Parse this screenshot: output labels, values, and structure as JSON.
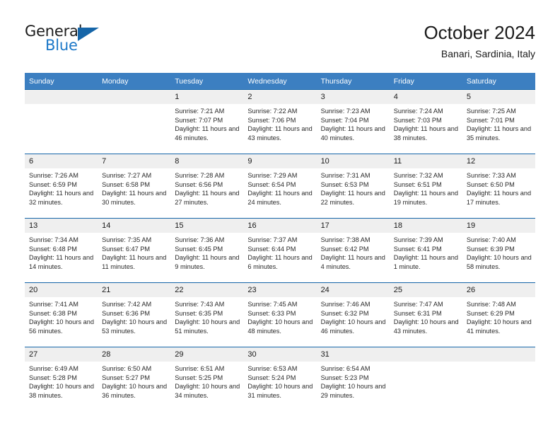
{
  "logo": {
    "word_one": "General",
    "word_two": "Blue",
    "triangle_icon": "blue-triangle-icon",
    "accent_color": "#1c78c8"
  },
  "header": {
    "title": "October 2024",
    "subtitle": "Banari, Sardinia, Italy"
  },
  "theme": {
    "header_blue": "#3c7fc1",
    "rule_blue": "#1565a8",
    "date_band_gray": "#efefef"
  },
  "labels": {
    "sunrise_prefix": "Sunrise:",
    "sunset_prefix": "Sunset:",
    "daylight_prefix": "Daylight:"
  },
  "weekdays": [
    "Sunday",
    "Monday",
    "Tuesday",
    "Wednesday",
    "Thursday",
    "Friday",
    "Saturday"
  ],
  "weeks": [
    [
      {
        "day": "",
        "sunrise": "",
        "sunset": "",
        "daylight": ""
      },
      {
        "day": "",
        "sunrise": "",
        "sunset": "",
        "daylight": ""
      },
      {
        "day": "1",
        "sunrise": "Sunrise: 7:21 AM",
        "sunset": "Sunset: 7:07 PM",
        "daylight": "Daylight: 11 hours and 46 minutes."
      },
      {
        "day": "2",
        "sunrise": "Sunrise: 7:22 AM",
        "sunset": "Sunset: 7:06 PM",
        "daylight": "Daylight: 11 hours and 43 minutes."
      },
      {
        "day": "3",
        "sunrise": "Sunrise: 7:23 AM",
        "sunset": "Sunset: 7:04 PM",
        "daylight": "Daylight: 11 hours and 40 minutes."
      },
      {
        "day": "4",
        "sunrise": "Sunrise: 7:24 AM",
        "sunset": "Sunset: 7:03 PM",
        "daylight": "Daylight: 11 hours and 38 minutes."
      },
      {
        "day": "5",
        "sunrise": "Sunrise: 7:25 AM",
        "sunset": "Sunset: 7:01 PM",
        "daylight": "Daylight: 11 hours and 35 minutes."
      }
    ],
    [
      {
        "day": "6",
        "sunrise": "Sunrise: 7:26 AM",
        "sunset": "Sunset: 6:59 PM",
        "daylight": "Daylight: 11 hours and 32 minutes."
      },
      {
        "day": "7",
        "sunrise": "Sunrise: 7:27 AM",
        "sunset": "Sunset: 6:58 PM",
        "daylight": "Daylight: 11 hours and 30 minutes."
      },
      {
        "day": "8",
        "sunrise": "Sunrise: 7:28 AM",
        "sunset": "Sunset: 6:56 PM",
        "daylight": "Daylight: 11 hours and 27 minutes."
      },
      {
        "day": "9",
        "sunrise": "Sunrise: 7:29 AM",
        "sunset": "Sunset: 6:54 PM",
        "daylight": "Daylight: 11 hours and 24 minutes."
      },
      {
        "day": "10",
        "sunrise": "Sunrise: 7:31 AM",
        "sunset": "Sunset: 6:53 PM",
        "daylight": "Daylight: 11 hours and 22 minutes."
      },
      {
        "day": "11",
        "sunrise": "Sunrise: 7:32 AM",
        "sunset": "Sunset: 6:51 PM",
        "daylight": "Daylight: 11 hours and 19 minutes."
      },
      {
        "day": "12",
        "sunrise": "Sunrise: 7:33 AM",
        "sunset": "Sunset: 6:50 PM",
        "daylight": "Daylight: 11 hours and 17 minutes."
      }
    ],
    [
      {
        "day": "13",
        "sunrise": "Sunrise: 7:34 AM",
        "sunset": "Sunset: 6:48 PM",
        "daylight": "Daylight: 11 hours and 14 minutes."
      },
      {
        "day": "14",
        "sunrise": "Sunrise: 7:35 AM",
        "sunset": "Sunset: 6:47 PM",
        "daylight": "Daylight: 11 hours and 11 minutes."
      },
      {
        "day": "15",
        "sunrise": "Sunrise: 7:36 AM",
        "sunset": "Sunset: 6:45 PM",
        "daylight": "Daylight: 11 hours and 9 minutes."
      },
      {
        "day": "16",
        "sunrise": "Sunrise: 7:37 AM",
        "sunset": "Sunset: 6:44 PM",
        "daylight": "Daylight: 11 hours and 6 minutes."
      },
      {
        "day": "17",
        "sunrise": "Sunrise: 7:38 AM",
        "sunset": "Sunset: 6:42 PM",
        "daylight": "Daylight: 11 hours and 4 minutes."
      },
      {
        "day": "18",
        "sunrise": "Sunrise: 7:39 AM",
        "sunset": "Sunset: 6:41 PM",
        "daylight": "Daylight: 11 hours and 1 minute."
      },
      {
        "day": "19",
        "sunrise": "Sunrise: 7:40 AM",
        "sunset": "Sunset: 6:39 PM",
        "daylight": "Daylight: 10 hours and 58 minutes."
      }
    ],
    [
      {
        "day": "20",
        "sunrise": "Sunrise: 7:41 AM",
        "sunset": "Sunset: 6:38 PM",
        "daylight": "Daylight: 10 hours and 56 minutes."
      },
      {
        "day": "21",
        "sunrise": "Sunrise: 7:42 AM",
        "sunset": "Sunset: 6:36 PM",
        "daylight": "Daylight: 10 hours and 53 minutes."
      },
      {
        "day": "22",
        "sunrise": "Sunrise: 7:43 AM",
        "sunset": "Sunset: 6:35 PM",
        "daylight": "Daylight: 10 hours and 51 minutes."
      },
      {
        "day": "23",
        "sunrise": "Sunrise: 7:45 AM",
        "sunset": "Sunset: 6:33 PM",
        "daylight": "Daylight: 10 hours and 48 minutes."
      },
      {
        "day": "24",
        "sunrise": "Sunrise: 7:46 AM",
        "sunset": "Sunset: 6:32 PM",
        "daylight": "Daylight: 10 hours and 46 minutes."
      },
      {
        "day": "25",
        "sunrise": "Sunrise: 7:47 AM",
        "sunset": "Sunset: 6:31 PM",
        "daylight": "Daylight: 10 hours and 43 minutes."
      },
      {
        "day": "26",
        "sunrise": "Sunrise: 7:48 AM",
        "sunset": "Sunset: 6:29 PM",
        "daylight": "Daylight: 10 hours and 41 minutes."
      }
    ],
    [
      {
        "day": "27",
        "sunrise": "Sunrise: 6:49 AM",
        "sunset": "Sunset: 5:28 PM",
        "daylight": "Daylight: 10 hours and 38 minutes."
      },
      {
        "day": "28",
        "sunrise": "Sunrise: 6:50 AM",
        "sunset": "Sunset: 5:27 PM",
        "daylight": "Daylight: 10 hours and 36 minutes."
      },
      {
        "day": "29",
        "sunrise": "Sunrise: 6:51 AM",
        "sunset": "Sunset: 5:25 PM",
        "daylight": "Daylight: 10 hours and 34 minutes."
      },
      {
        "day": "30",
        "sunrise": "Sunrise: 6:53 AM",
        "sunset": "Sunset: 5:24 PM",
        "daylight": "Daylight: 10 hours and 31 minutes."
      },
      {
        "day": "31",
        "sunrise": "Sunrise: 6:54 AM",
        "sunset": "Sunset: 5:23 PM",
        "daylight": "Daylight: 10 hours and 29 minutes."
      },
      {
        "day": "",
        "sunrise": "",
        "sunset": "",
        "daylight": ""
      },
      {
        "day": "",
        "sunrise": "",
        "sunset": "",
        "daylight": ""
      }
    ]
  ]
}
